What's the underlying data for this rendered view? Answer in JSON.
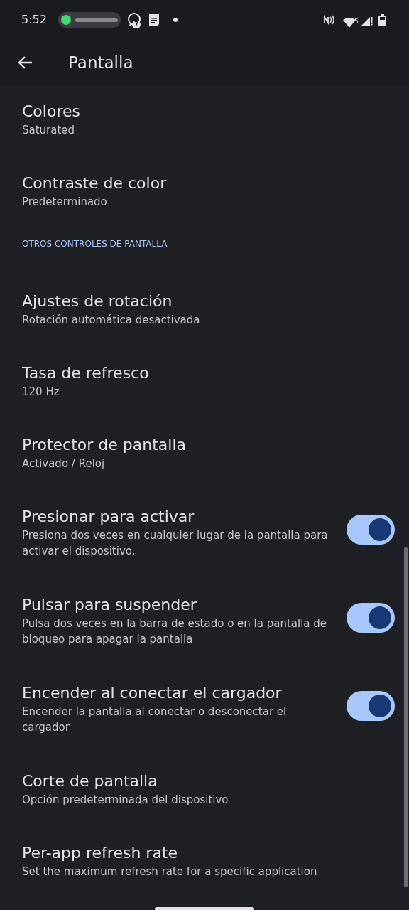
{
  "status_bar": {
    "time": "5:52",
    "notification_badge": "7",
    "wifi_label": "5"
  },
  "app_bar": {
    "title": "Pantalla"
  },
  "items": [
    {
      "kind": "plain",
      "title": "Colores",
      "summary": "Saturated"
    },
    {
      "kind": "plain",
      "title": "Contraste de color",
      "summary": "Predeterminado"
    },
    {
      "kind": "header",
      "title": "OTROS CONTROLES DE PANTALLA"
    },
    {
      "kind": "plain",
      "title": "Ajustes de rotación",
      "summary": "Rotación automática desactivada"
    },
    {
      "kind": "plain",
      "title": "Tasa de refresco",
      "summary": "120 Hz"
    },
    {
      "kind": "plain",
      "title": "Protector de pantalla",
      "summary": "Activado / Reloj"
    },
    {
      "kind": "switch",
      "title": "Presionar para activar",
      "summary": "Presiona dos veces en cualquier lugar de la pantalla para activar el dispositivo.",
      "on": true
    },
    {
      "kind": "switch",
      "title": "Pulsar para suspender",
      "summary": "Pulsa dos veces en la barra de estado o en la pantalla de bloqueo para apagar la pantalla",
      "on": true
    },
    {
      "kind": "switch",
      "title": "Encender al conectar el cargador",
      "summary": "Encender la pantalla al conectar o desconectar el cargador",
      "on": true
    },
    {
      "kind": "plain",
      "title": "Corte de pantalla",
      "summary": "Opción predeterminada del dispositivo"
    },
    {
      "kind": "plain",
      "title": "Per-app refresh rate",
      "summary": "Set the maximum refresh rate for a specific application"
    }
  ]
}
